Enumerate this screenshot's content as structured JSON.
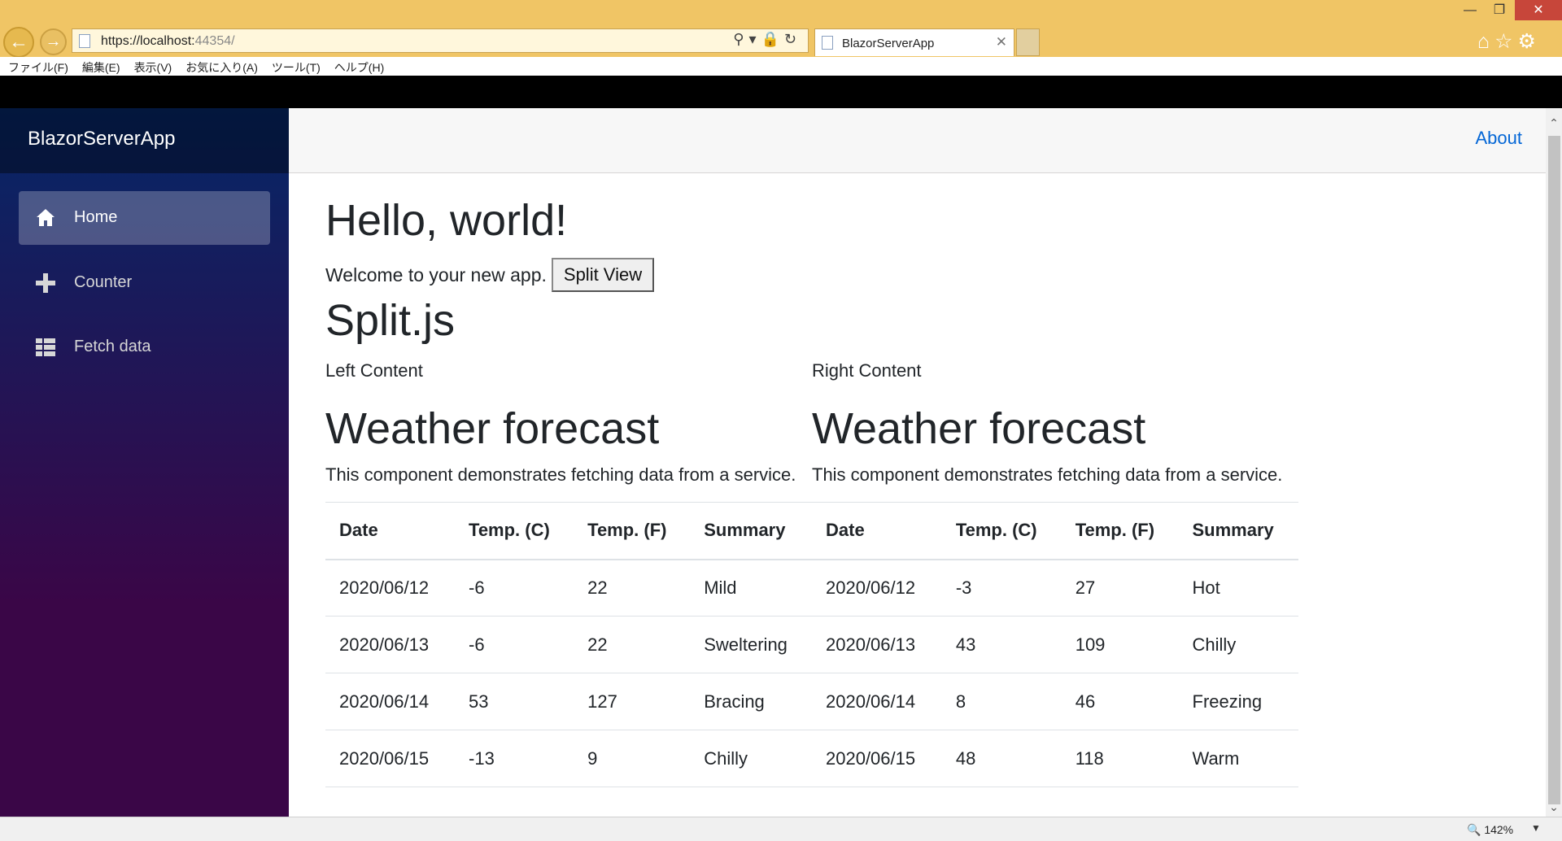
{
  "browser": {
    "url_host": "https://localhost:",
    "url_port": "44354/",
    "tab_title": "BlazorServerApp",
    "menu": [
      "ファイル(F)",
      "編集(E)",
      "表示(V)",
      "お気に入り(A)",
      "ツール(T)",
      "ヘルプ(H)"
    ],
    "zoom": "142%"
  },
  "sidebar": {
    "brand": "BlazorServerApp",
    "items": [
      {
        "label": "Home",
        "icon": "home-icon",
        "active": true
      },
      {
        "label": "Counter",
        "icon": "plus-icon",
        "active": false
      },
      {
        "label": "Fetch data",
        "icon": "list-icon",
        "active": false
      }
    ]
  },
  "header": {
    "about": "About"
  },
  "main": {
    "title": "Hello, world!",
    "welcome": "Welcome to your new app.",
    "split_button": "Split View",
    "split_heading": "Split.js",
    "left": {
      "label": "Left Content",
      "title": "Weather forecast",
      "desc": "This component demonstrates fetching data from a service.",
      "columns": [
        "Date",
        "Temp. (C)",
        "Temp. (F)",
        "Summary"
      ],
      "rows": [
        [
          "2020/06/12",
          "-6",
          "22",
          "Mild"
        ],
        [
          "2020/06/13",
          "-6",
          "22",
          "Sweltering"
        ],
        [
          "2020/06/14",
          "53",
          "127",
          "Bracing"
        ],
        [
          "2020/06/15",
          "-13",
          "9",
          "Chilly"
        ]
      ]
    },
    "right": {
      "label": "Right Content",
      "title": "Weather forecast",
      "desc": "This component demonstrates fetching data from a service.",
      "columns": [
        "Date",
        "Temp. (C)",
        "Temp. (F)",
        "Summary"
      ],
      "rows": [
        [
          "2020/06/12",
          "-3",
          "27",
          "Hot"
        ],
        [
          "2020/06/13",
          "43",
          "109",
          "Chilly"
        ],
        [
          "2020/06/14",
          "8",
          "46",
          "Freezing"
        ],
        [
          "2020/06/15",
          "48",
          "118",
          "Warm"
        ]
      ]
    }
  }
}
